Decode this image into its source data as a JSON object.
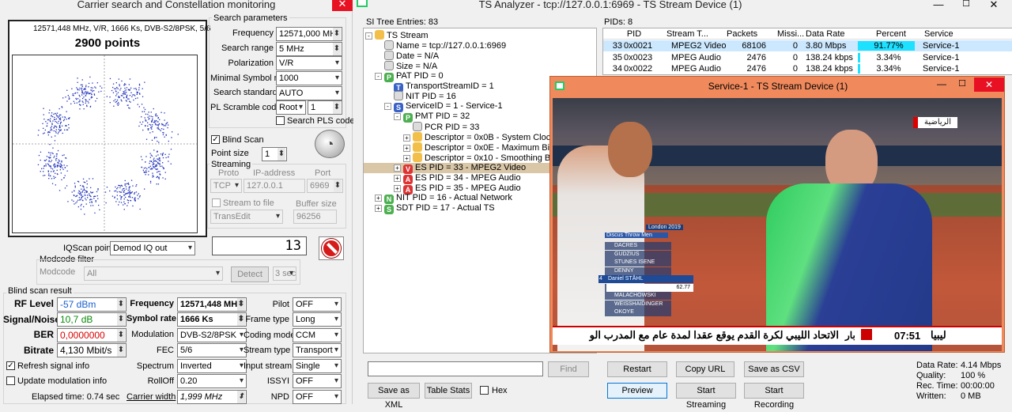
{
  "left_window": {
    "title": "Carrier search and Constellation monitoring"
  },
  "constellation": {
    "info": "12571,448 MHz, V/R, 1666 Ks, DVB-S2/8PSK, 5/6",
    "points": "2900 points"
  },
  "search_params": {
    "group": "Search parameters",
    "frequency_label": "Frequency",
    "frequency": "12571,000 MHz",
    "search_range_label": "Search range",
    "search_range": "5 MHz",
    "polarization_label": "Polarization",
    "polarization": "V/R",
    "min_symbol_rate_label": "Minimal Symbol rate",
    "min_symbol_rate": "1000",
    "search_standard_label": "Search standard",
    "search_standard": "AUTO",
    "pl_scramble_label": "PL Scramble code",
    "pl_scramble": "Root",
    "pl_scramble_num": "1",
    "search_pls_label": "Search PLS code"
  },
  "blind": {
    "blind_scan_label": "Blind Scan",
    "point_size_label": "Point size",
    "point_size": "1"
  },
  "streaming": {
    "group": "Streaming",
    "proto_label": "Proto",
    "ip_label": "IP-address",
    "port_label": "Port",
    "proto": "TCP",
    "ip": "127.0.0.1",
    "port": "6969",
    "stream_to_file_label": "Stream to file",
    "buffer_size_label": "Buffer size",
    "transedit": "TransEdit",
    "buffer_size": "96256"
  },
  "iq": {
    "iqscan_label": "IQScan point",
    "iqscan": "Demod IQ out",
    "modcode_filter": "Modcode filter",
    "modcode_label": "Modcode",
    "modcode": "All",
    "detect": "Detect",
    "sec": "3 sec",
    "display": "13"
  },
  "blind_result": {
    "group": "Blind scan result",
    "rf_level_label": "RF Level",
    "rf_level": "-57 dBm",
    "sn_label": "Signal/Noise",
    "sn": "10,7 dB",
    "ber_label": "BER",
    "ber": "0,0000000",
    "bitrate_label": "Bitrate",
    "bitrate": "4,130 Mbit/s",
    "freq_label": "Frequency",
    "freq": "12571,448 MHz",
    "symrate_label": "Symbol rate",
    "symrate": "1666 Ks",
    "mod_label": "Modulation",
    "mod": "DVB-S2/8PSK",
    "fec_label": "FEC",
    "fec": "5/6",
    "spectrum_label": "Spectrum",
    "spectrum": "Inverted",
    "rolloff_label": "RollOff",
    "rolloff": "0.20",
    "carrier_width_label": "Carrier width",
    "carrier_width": "1,999 MHz",
    "pilot_label": "Pilot",
    "pilot": "OFF",
    "frame_label": "Frame type",
    "frame": "Long",
    "coding_label": "Coding mode",
    "coding": "CCM",
    "stream_type_label": "Stream type",
    "stream_type": "Transport",
    "input_stream_label": "Input stream",
    "input_stream": "Single",
    "issyi_label": "ISSYI",
    "issyi": "OFF",
    "npd_label": "NPD",
    "npd": "OFF",
    "refresh_label": "Refresh signal info",
    "update_mod_label": "Update modulation info",
    "elapsed": "Elapsed time: 0.74 sec"
  },
  "ts_window": {
    "title": "TS Analyzer - tcp://127.0.0.1:6969 - TS Stream Device (1)",
    "si_entries": "SI Tree Entries: 83",
    "pids_count": "PIDs: 8"
  },
  "tree": [
    {
      "text": "TS Stream",
      "icon": "folder",
      "exp": "-"
    },
    {
      "text": "Name = tcp://127.0.0.1:6969",
      "icon": "doc"
    },
    {
      "text": "Date = N/A",
      "icon": "doc"
    },
    {
      "text": "Size = N/A",
      "icon": "doc"
    },
    {
      "text": "PAT PID = 0",
      "icon": "P",
      "exp": "-"
    },
    {
      "text": "TransportStreamID = 1",
      "icon": "T"
    },
    {
      "text": "NIT PID = 16",
      "icon": "doc"
    },
    {
      "text": "ServiceID = 1 - Service-1",
      "icon": "S",
      "exp": "-"
    },
    {
      "text": "PMT PID = 32",
      "icon": "P",
      "exp": "-"
    },
    {
      "text": "PCR PID = 33",
      "icon": "doc"
    },
    {
      "text": "Descriptor = 0x0B - System Clock",
      "icon": "desc",
      "exp": "+"
    },
    {
      "text": "Descriptor = 0x0E - Maximum Bitrate",
      "icon": "desc",
      "exp": "+"
    },
    {
      "text": "Descriptor = 0x10 - Smoothing Buffer",
      "icon": "desc",
      "exp": "+"
    },
    {
      "text": "ES PID = 33 - MPEG2 Video",
      "icon": "V",
      "exp": "+"
    },
    {
      "text": "ES PID = 34 - MPEG Audio",
      "icon": "A",
      "exp": "+"
    },
    {
      "text": "ES PID = 35 - MPEG Audio",
      "icon": "A",
      "exp": "+"
    },
    {
      "text": "NIT PID = 16 - Actual Network",
      "icon": "N",
      "exp": "+"
    },
    {
      "text": "SDT PID = 17 - Actual TS",
      "icon": "S2",
      "exp": "+"
    }
  ],
  "pid_table": {
    "headers": [
      "PID",
      "Stream T...",
      "Packets",
      "Missi...",
      "Data Rate",
      "Percent",
      "Service"
    ],
    "rows": [
      {
        "pid_dec": "33",
        "pid": "0x0021",
        "type": "MPEG2 Video",
        "packets": "68106",
        "missing": "0",
        "rate": "3.80 Mbps",
        "percent": "91.77%",
        "pct": 91.77,
        "service": "Service-1"
      },
      {
        "pid_dec": "35",
        "pid": "0x0023",
        "type": "MPEG Audio",
        "packets": "2476",
        "missing": "0",
        "rate": "138.24 kbps",
        "percent": "3.34%",
        "pct": 3.34,
        "service": "Service-1"
      },
      {
        "pid_dec": "34",
        "pid": "0x0022",
        "type": "MPEG Audio",
        "packets": "2476",
        "missing": "0",
        "rate": "138.24 kbps",
        "percent": "3.34%",
        "pct": 3.34,
        "service": "Service-1"
      }
    ]
  },
  "video_window": {
    "title": "Service-1 - TS Stream Device (1)",
    "event": "London 2019",
    "discipline": "Discus Throw Men",
    "athletes": [
      "DACRES",
      "GUDZIUS",
      "STUNES ISENE",
      "DENNY",
      "Daniel STÅHL",
      "",
      "MALACHOWSKI",
      "WEISSHAIDINGER",
      "OKOYE"
    ],
    "leader_mark": "62.77",
    "current_num": "4",
    "clock": "07:51",
    "channel": "الرياضية",
    "ticker": "الاتحاد الليبي لكرة القدم يوقع عقدا لمدة عام مع المدرب الو",
    "ticker_right": "ليبيا",
    "ticker_left": "بار"
  },
  "controls": {
    "find": "Find",
    "save_xml": "Save as XML",
    "table_stats": "Table Stats",
    "hex": "Hex",
    "restart": "Restart",
    "copy_url": "Copy URL",
    "save_csv": "Save as CSV",
    "preview": "Preview",
    "start_streaming": "Start Streaming",
    "start_recording": "Start Recording"
  },
  "stats": {
    "data_rate_label": "Data Rate:",
    "data_rate": "4.14 Mbps",
    "quality_label": "Quality:",
    "quality": "100 %",
    "rec_time_label": "Rec. Time:",
    "rec_time": "00:00:00",
    "written_label": "Written:",
    "written": "0 MB"
  },
  "colors": {
    "percent_bar": "#1ee0ff",
    "selected_row": "#cce8ff",
    "tree_sel": "#d9c7a8",
    "video_frame": "#f08a5d"
  }
}
